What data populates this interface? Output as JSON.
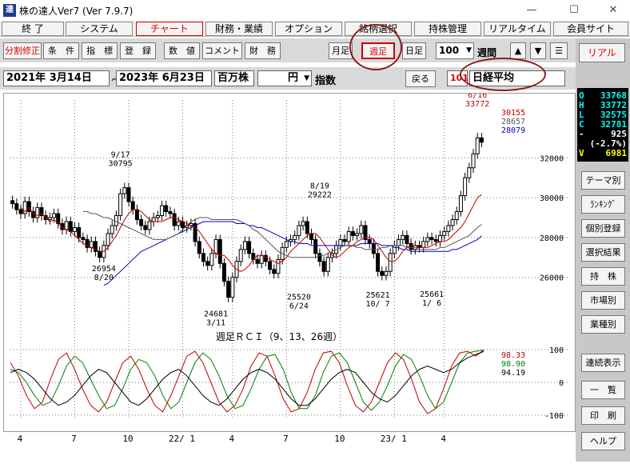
{
  "window": {
    "title": "株の達人Ver7 (Ver 7.9.7)",
    "logo": "達",
    "minimize": "—",
    "maximize": "☐",
    "close": "✕"
  },
  "menu": [
    {
      "label": "終 了"
    },
    {
      "label": "システム"
    },
    {
      "label": "チャート",
      "active": true
    },
    {
      "label": "財務・業績"
    },
    {
      "label": "オプション"
    },
    {
      "label": "銘柄選択"
    },
    {
      "label": "持株管理"
    },
    {
      "label": "リアルタイム"
    },
    {
      "label": "会員サイト"
    }
  ],
  "toolbar": {
    "left": [
      "分割修正",
      "条　件",
      "指　標",
      "登　録",
      "数　値",
      "コメント",
      "財　務"
    ],
    "period_month": "月足",
    "period_week": "週足",
    "period_day": "日足",
    "count_value": "100",
    "span_label": "週間",
    "up_icon": "▲",
    "down_icon": "▼",
    "menu_icon": "☰",
    "real_button": "リアル"
  },
  "datebar": {
    "from": "2021年 3月14日",
    "tilde": "〜",
    "to": "2023年 6月23日",
    "unit": "百万株",
    "currency": "円",
    "dropdown_icon": "▼",
    "index_label": "指数",
    "back_button": "戻る",
    "code": "101",
    "name": "日経平均"
  },
  "quote": [
    {
      "key": "O",
      "value": "33768",
      "color": "#00ffff"
    },
    {
      "key": "H",
      "value": "33772",
      "color": "#00ffff"
    },
    {
      "key": "L",
      "value": "32575",
      "color": "#00ffff"
    },
    {
      "key": "C",
      "value": "32781",
      "color": "#00ffff"
    },
    {
      "key": "-",
      "value": "925",
      "color": "#ffffff"
    },
    {
      "key": "",
      "value": "(-2.7%)",
      "color": "#ffffff"
    },
    {
      "key": "V",
      "value": "6981",
      "color": "#ffff00"
    }
  ],
  "side_buttons": [
    "テーマ別",
    "ﾗﾝｷﾝｸﾞ",
    "個別登録",
    "選択結果",
    "持　株",
    "市場別",
    "業種別",
    "連続表示",
    "一　覧",
    "印　刷",
    "ヘルプ"
  ],
  "chart_data": [
    {
      "type": "candlestick",
      "y_ticks": [
        26000,
        28000,
        30000,
        32000
      ],
      "ylim": [
        23500,
        34500
      ],
      "x_ticks": [
        "4",
        "7",
        "10",
        "22/ 1",
        "4",
        "7",
        "10",
        "23/ 1",
        "4"
      ],
      "ma_legend": [
        {
          "value": "30155",
          "color": "#c00000"
        },
        {
          "value": "28657",
          "color": "#555555"
        },
        {
          "value": "28079",
          "color": "#0000c0"
        }
      ],
      "annotations": [
        {
          "label_top": "9/17",
          "label_bottom": "30795",
          "value": 30795
        },
        {
          "label_top": "8/20",
          "label_bottom": "26954",
          "value": 26954
        },
        {
          "label_top": "3/11",
          "label_bottom": "24681",
          "value": 24681
        },
        {
          "label_top": "6/24",
          "label_bottom": "25520",
          "value": 25520
        },
        {
          "label_top": "8/19",
          "label_bottom": "29222",
          "value": 29222
        },
        {
          "label_top": "10/ 7",
          "label_bottom": "25621",
          "value": 25621
        },
        {
          "label_top": "1/ 6",
          "label_bottom": "25661",
          "value": 25661
        },
        {
          "label_top": "6/16",
          "label_bottom": "33772",
          "value": 33772
        }
      ],
      "closes": [
        29700,
        29400,
        29200,
        29800,
        29300,
        29000,
        29500,
        29100,
        28900,
        29000,
        29200,
        28700,
        28400,
        28800,
        28300,
        28500,
        28000,
        27900,
        27500,
        27800,
        27300,
        27000,
        27600,
        28200,
        28600,
        29100,
        30200,
        30500,
        29800,
        29400,
        28900,
        28600,
        28400,
        28800,
        29000,
        29100,
        29600,
        29300,
        29200,
        28600,
        28800,
        28500,
        28600,
        28700,
        27800,
        27200,
        26800,
        26600,
        27200,
        27900,
        26700,
        25800,
        25000,
        26000,
        26800,
        27400,
        27800,
        27200,
        26900,
        26700,
        27100,
        26800,
        26400,
        26200,
        26900,
        27500,
        27800,
        27900,
        28100,
        28600,
        28800,
        28200,
        27900,
        27200,
        26800,
        26300,
        27000,
        27200,
        27600,
        27900,
        27800,
        28300,
        28100,
        28200,
        28600,
        27900,
        27700,
        27200,
        26300,
        26100,
        26300,
        27200,
        27600,
        27900,
        28100,
        27700,
        27400,
        27600,
        27500,
        27800,
        28000,
        27900,
        27800,
        28100,
        28300,
        28600,
        28900,
        29300,
        30100,
        31000,
        31500,
        32200,
        33000,
        32781
      ],
      "ma_short": [
        29500,
        29300,
        29500,
        29200,
        29100,
        29200,
        29000,
        28800,
        28900,
        28700,
        28500,
        28400,
        28300,
        28100,
        27900,
        27700,
        27600,
        27500,
        27400,
        27300,
        27300,
        27500,
        27800,
        28100,
        28500,
        28900,
        29200,
        29400,
        29400,
        29300,
        29100,
        28900,
        28800,
        28800,
        28800,
        28900,
        29000,
        29000,
        28900,
        28800,
        28700,
        28600,
        28500,
        28300,
        28000,
        27700,
        27400,
        27200,
        27100,
        27100,
        26900,
        26600,
        26400,
        26300,
        26400,
        26600,
        26900,
        27100,
        27100,
        27000,
        26900,
        26800,
        26700,
        26800,
        27000,
        27300,
        27500,
        27700,
        27900,
        28100,
        28200,
        28200,
        28000,
        27700,
        27400,
        27100,
        27000,
        27100,
        27300,
        27500,
        27600,
        27800,
        27900,
        28000,
        28000,
        27900,
        27600,
        27300,
        27000,
        26800,
        26800,
        27000,
        27300,
        27500,
        27600,
        27600,
        27500,
        27500,
        27500,
        27600,
        27700,
        27800,
        27800,
        27900,
        28100,
        28300,
        28500,
        28800,
        29200,
        29600,
        30000,
        30155
      ],
      "ma_mid": [
        29300,
        29300,
        29200,
        29200,
        29100,
        29000,
        29000,
        28900,
        28800,
        28700,
        28600,
        28500,
        28400,
        28300,
        28200,
        28100,
        28000,
        27900,
        27900,
        27900,
        27900,
        28000,
        28100,
        28200,
        28400,
        28600,
        28800,
        28900,
        29000,
        29000,
        29000,
        28900,
        28900,
        28900,
        28900,
        28900,
        28900,
        28900,
        28800,
        28700,
        28600,
        28400,
        28300,
        28100,
        27900,
        27700,
        27500,
        27300,
        27200,
        27100,
        27000,
        27000,
        27000,
        27000,
        27000,
        27000,
        27000,
        27100,
        27100,
        27200,
        27300,
        27400,
        27500,
        27600,
        27600,
        27600,
        27500,
        27500,
        27400,
        27400,
        27400,
        27400,
        27500,
        27500,
        27600,
        27600,
        27600,
        27600,
        27500,
        27500,
        27500,
        27400,
        27400,
        27400,
        27400,
        27400,
        27500,
        27500,
        27600,
        27700,
        27800,
        27900,
        28000,
        28100,
        28300,
        28500,
        28657
      ],
      "ma_long": [
        25600,
        25700,
        25900,
        26100,
        26300,
        26500,
        26700,
        26900,
        27100,
        27300,
        27400,
        27500,
        27600,
        27700,
        27800,
        27900,
        28000,
        28100,
        28200,
        28300,
        28400,
        28500,
        28600,
        28700,
        28800,
        28800,
        28800,
        28800,
        28800,
        28800,
        28800,
        28800,
        28700,
        28700,
        28700,
        28600,
        28600,
        28500,
        28500,
        28400,
        28300,
        28200,
        28100,
        28000,
        27900,
        27800,
        27800,
        27700,
        27700,
        27700,
        27600,
        27600,
        27600,
        27600,
        27600,
        27600,
        27600,
        27600,
        27600,
        27600,
        27600,
        27600,
        27700,
        27700,
        27700,
        27700,
        27700,
        27600,
        27600,
        27600,
        27500,
        27500,
        27400,
        27400,
        27300,
        27300,
        27300,
        27300,
        27300,
        27300,
        27300,
        27300,
        27300,
        27300,
        27400,
        27400,
        27500,
        27600,
        27700,
        27800,
        27900,
        28079
      ]
    },
    {
      "type": "line",
      "title": "週足ＲＣＩ（9、13、26週）",
      "y_ticks": [
        100,
        0,
        -100
      ],
      "ylim": [
        -100,
        100
      ],
      "legend": [
        {
          "value": "98.33",
          "color": "#c00000"
        },
        {
          "value": "98.90",
          "color": "#008000"
        },
        {
          "value": "94.19",
          "color": "#000000"
        }
      ],
      "series": [
        {
          "color": "#c00000",
          "values": [
            60,
            20,
            -40,
            -80,
            -60,
            10,
            70,
            90,
            40,
            -20,
            -70,
            -90,
            -60,
            0,
            60,
            80,
            40,
            -20,
            -70,
            -90,
            -40,
            20,
            80,
            95,
            60,
            0,
            -60,
            -90,
            -70,
            -20,
            50,
            90,
            80,
            20,
            -50,
            -90,
            -80,
            -30,
            40,
            90,
            95,
            60,
            -10,
            -70,
            -90,
            -60,
            0,
            60,
            90,
            70,
            10,
            -60,
            -95,
            -80,
            -20,
            50,
            90,
            95,
            80,
            98.33
          ]
        },
        {
          "color": "#008000",
          "values": [
            40,
            30,
            0,
            -40,
            -70,
            -60,
            -10,
            50,
            80,
            60,
            10,
            -40,
            -80,
            -70,
            -20,
            40,
            70,
            60,
            20,
            -40,
            -80,
            -60,
            0,
            60,
            90,
            70,
            20,
            -40,
            -80,
            -70,
            -20,
            40,
            80,
            85,
            40,
            -30,
            -80,
            -80,
            -40,
            30,
            80,
            90,
            60,
            0,
            -60,
            -85,
            -60,
            -10,
            50,
            85,
            70,
            20,
            -40,
            -80,
            -60,
            0,
            60,
            90,
            95,
            98.9
          ]
        },
        {
          "color": "#000000",
          "values": [
            30,
            40,
            30,
            10,
            -20,
            -50,
            -70,
            -60,
            -40,
            -10,
            20,
            40,
            30,
            0,
            -30,
            -60,
            -70,
            -50,
            -20,
            10,
            30,
            40,
            20,
            -10,
            -40,
            -60,
            -70,
            -50,
            -20,
            10,
            30,
            40,
            30,
            10,
            -20,
            -50,
            -70,
            -70,
            -50,
            -20,
            10,
            30,
            40,
            30,
            0,
            -30,
            -50,
            -60,
            -40,
            -10,
            20,
            40,
            50,
            40,
            30,
            40,
            60,
            75,
            85,
            94.19
          ]
        }
      ]
    }
  ]
}
